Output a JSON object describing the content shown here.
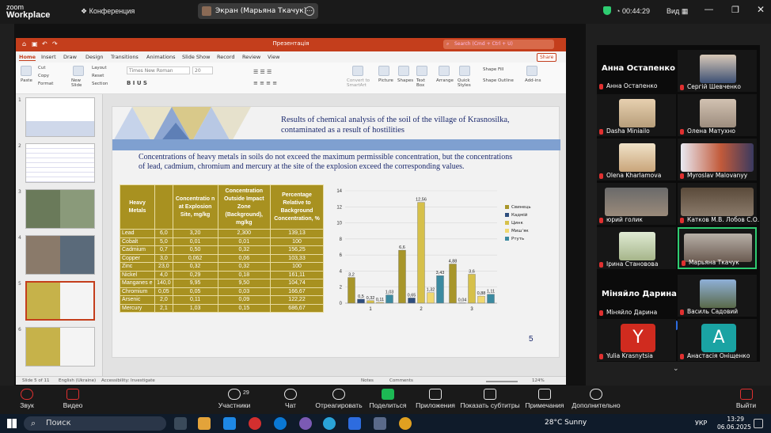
{
  "zoom": {
    "logo_top": "zoom",
    "logo_bottom": "Workplace",
    "meeting_label": "Конференция",
    "share_chip": "Экран (Марьяна Ткачук)",
    "timer": "00:44:29",
    "view_label": "Вид"
  },
  "ppt": {
    "doc_title": "Презентація",
    "search_placeholder": "Search (Cmd + Ctrl + U)",
    "share_label": "Share",
    "menu": [
      "Home",
      "Insert",
      "Draw",
      "Design",
      "Transitions",
      "Animations",
      "Slide Show",
      "Record",
      "Review",
      "View"
    ],
    "font_name": "Times New Roman",
    "font_size": "20",
    "ribbon_labels": {
      "paste": "Paste",
      "cut": "Cut",
      "copy": "Copy",
      "format": "Format",
      "new_slide": "New Slide",
      "layout": "Layout",
      "reset": "Reset",
      "section": "Section",
      "convert": "Convert to SmartArt",
      "picture": "Picture",
      "shapes": "Shapes",
      "text_box": "Text Box",
      "arrange": "Arrange",
      "quick_styles": "Quick Styles",
      "shape_fill": "Shape Fill",
      "shape_outline": "Shape Outline",
      "addins": "Add-ins"
    },
    "thumb_numbers": [
      "1",
      "2",
      "3",
      "4",
      "5",
      "6"
    ],
    "status": {
      "slide": "Slide 5 of 11",
      "lang": "English (Ukraine)",
      "access": "Accessibility: Investigate",
      "notes": "Notes",
      "comments": "Comments",
      "zoom": "124%"
    }
  },
  "slide": {
    "title_line1": "Results of chemical analysis of the soil of the village of Krasnosilka,",
    "title_line2": "contaminated as a result of hostilities",
    "paragraph": "Concentrations of heavy metals in soils do not exceed the maximum permissible concentration, but the concentrations of lead, cadmium, chromium and mercury at the site of the explosion exceed the corresponding values.",
    "page_number": "5",
    "table": {
      "headers": [
        "Heavy Metals",
        "",
        "Concentratio n at Explosion Site, mg/kg",
        "Concentration Outside Impact Zone (Background), mg/kg",
        "Percentage Relative to Background Concentration, %"
      ],
      "rows": [
        [
          "Lead",
          "6,0",
          "3,20",
          "2,300",
          "139,13"
        ],
        [
          "Cobalt",
          "5,0",
          "0,01",
          "0,01",
          "100"
        ],
        [
          "Cadmium",
          "0,7",
          "0,50",
          "0,32",
          "156,25"
        ],
        [
          "Copper",
          "3,0",
          "0,062",
          "0,06",
          "103,33"
        ],
        [
          "Zinc",
          "23,0",
          "0,32",
          "0,32",
          "100"
        ],
        [
          "Nickel",
          "4,0",
          "0,29",
          "0,18",
          "161,11"
        ],
        [
          "Manganes e",
          "140,0",
          "9,95",
          "9,50",
          "104,74"
        ],
        [
          "Chromium",
          "0,05",
          "0,05",
          "0,03",
          "166,67"
        ],
        [
          "Arsenic",
          "2,0",
          "0,11",
          "0,09",
          "122,22"
        ],
        [
          "Mercury",
          "2,1",
          "1,03",
          "0,15",
          "686,67"
        ]
      ]
    }
  },
  "chart_data": {
    "type": "bar",
    "categories": [
      "1",
      "2",
      "3"
    ],
    "ylim": [
      0,
      14
    ],
    "yticks": [
      "0",
      "2",
      "4",
      "6",
      "8",
      "10",
      "12",
      "14"
    ],
    "series": [
      {
        "name": "Свинець",
        "color": "#a8962a",
        "values": [
          3.2,
          6.6,
          4.88
        ]
      },
      {
        "name": "Кадмій",
        "color": "#2e4e7e",
        "values": [
          0.5,
          0.65,
          0.04
        ]
      },
      {
        "name": "Цинк",
        "color": "#d6c04a",
        "values": [
          0.32,
          12.56,
          3.6
        ]
      },
      {
        "name": "Мишʼяк",
        "color": "#f0d870",
        "values": [
          0.11,
          1.32,
          0.88
        ]
      },
      {
        "name": "Ртуть",
        "color": "#3c8aa0",
        "values": [
          1.03,
          3.43,
          1.11
        ]
      }
    ],
    "labels": [
      [
        "3,2",
        "0,5",
        "0,32",
        "0,11",
        "1,03"
      ],
      [
        "6,6",
        "0,65",
        "12,56",
        "1,32",
        "3,43"
      ],
      [
        "4,88",
        "0,04",
        "3,6",
        "0,88",
        "1,11"
      ]
    ]
  },
  "participants": {
    "header_name": "Анна Остапенко",
    "tiles": [
      {
        "name": "Анна Остапенко"
      },
      {
        "name": "Сергій Шевченко"
      },
      {
        "name": "Dasha Miniailo"
      },
      {
        "name": "Олена Матухно"
      },
      {
        "name": "Olena Kharlamova"
      },
      {
        "name": "Myroslav Malovanyy"
      },
      {
        "name": "юрий голик"
      },
      {
        "name": "Катков М.В. Лобов С.О."
      },
      {
        "name": "Ірина Становова"
      },
      {
        "name": "Марьяна Ткачук"
      },
      {
        "name": "Міняйло Дарина"
      },
      {
        "name": "Василь Садовий"
      },
      {
        "name": "Yulia Krasnytsia"
      },
      {
        "name": "Анастасія Оніщенко"
      }
    ],
    "label_minyailo": "Міняйло Дарина",
    "initials": [
      "Y",
      "A"
    ],
    "more": "..."
  },
  "controls": {
    "audio": "Звук",
    "video": "Видео",
    "participants": "Участники",
    "participants_count": "29",
    "chat": "Чат",
    "react": "Отреагировать",
    "share": "Поделиться",
    "apps": "Приложения",
    "captions": "Показать субтитры",
    "notes": "Примечания",
    "more": "Дополнительно",
    "leave": "Выйти"
  },
  "taskbar": {
    "search": "Поиск",
    "weather": "28°C  Sunny",
    "lang": "УКР",
    "time": "13:29",
    "date": "06.06.2025"
  },
  "colors": {
    "ppt_accent": "#c43e1c",
    "table_gold": "#a89120",
    "slide_title": "#1c2a6e",
    "zoom_green": "#2ecc71"
  }
}
